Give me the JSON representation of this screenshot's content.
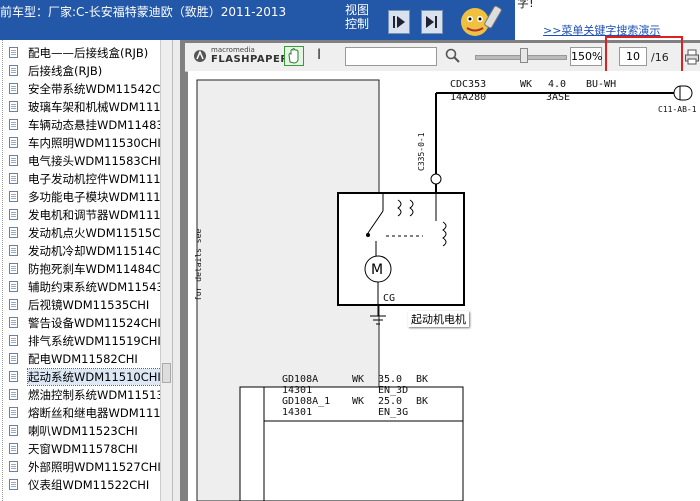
{
  "header": {
    "title": "前车型：厂家:C-长安福特蒙迪欧（致胜）2011-2013",
    "view_control": "视图控制",
    "ad_line1": "字!",
    "ad_link": ">>菜单关键字搜索演示"
  },
  "tree": {
    "items": [
      {
        "label": "配电——后接线盒(RJB)"
      },
      {
        "label": "后接线盒(RJB)"
      },
      {
        "label": "安全带系统WDM11542C"
      },
      {
        "label": "玻璃车架和机械WDM1115"
      },
      {
        "label": "车辆动态悬挂WDM11483"
      },
      {
        "label": "车内照明WDM11530CHI"
      },
      {
        "label": "电气接头WDM11583CHI"
      },
      {
        "label": "电子发动机控件WDM1115"
      },
      {
        "label": "多功能电子模块WDM1115"
      },
      {
        "label": "发电机和调节器WDM1115"
      },
      {
        "label": "发动机点火WDM11515C"
      },
      {
        "label": "发动机冷却WDM11514C"
      },
      {
        "label": "防抱死刹车WDM11484C"
      },
      {
        "label": "辅助约束系统WDM11543"
      },
      {
        "label": "后视镜WDM11535CHI"
      },
      {
        "label": "警告设备WDM11524CHI"
      },
      {
        "label": "排气系统WDM11519CHI"
      },
      {
        "label": "配电WDM11582CHI"
      },
      {
        "label": "起动系统WDM11510CHI",
        "selected": true
      },
      {
        "label": "燃油控制系统WDM11513"
      },
      {
        "label": "熔断丝和继电器WDM1115"
      },
      {
        "label": "喇叭WDM11523CHI"
      },
      {
        "label": "天窗WDM11578CHI"
      },
      {
        "label": "外部照明WDM11527CHI"
      },
      {
        "label": "仪表组WDM11522CHI"
      }
    ]
  },
  "toolbar": {
    "logo_small": "macromedia",
    "logo_big": "FLASHPAPER",
    "text_tool": "I",
    "find_value": "",
    "zoom": "150%",
    "zoom_level": 0.55,
    "page_current": "10",
    "page_total": "/16"
  },
  "schematic": {
    "wire_top_id": "CDC353",
    "wire_top_code": "14A280",
    "wire_top_wk": "WK",
    "wire_top_size": "4.0",
    "wire_top_color": "BU-WH",
    "wire_top_base": "3ASE",
    "connector_right": "C11-AB-1",
    "connector_vertical": "C335-0-1",
    "side_note": "for details see",
    "ground_label": "CG",
    "component_label": "起动机电机",
    "rows": [
      {
        "id": "GD108A",
        "wk": "WK",
        "size": "35.0",
        "color": "BK"
      },
      {
        "id": "14301",
        "wk": "",
        "size": "EN_3D",
        "color": ""
      },
      {
        "id": "GD108A_1",
        "wk": "WK",
        "size": "25.0",
        "color": "BK"
      },
      {
        "id": "14301",
        "wk": "",
        "size": "EN_3G",
        "color": ""
      }
    ]
  }
}
